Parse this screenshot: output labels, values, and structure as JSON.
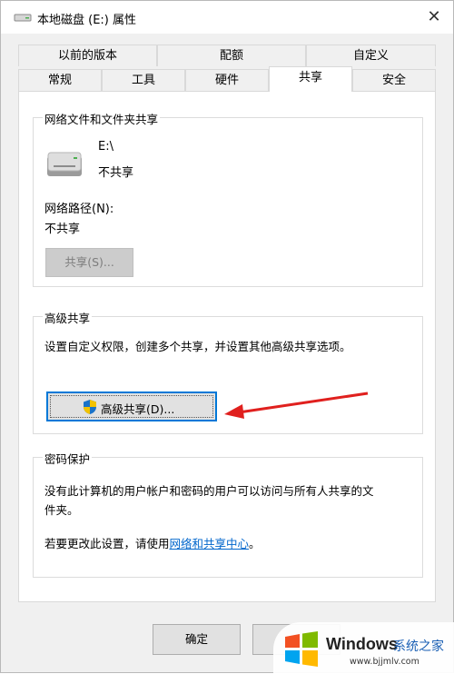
{
  "window": {
    "title": "本地磁盘 (E:) 属性",
    "close": "✕"
  },
  "tabs_top": [
    "以前的版本",
    "配额",
    "自定义"
  ],
  "tabs_bottom": [
    "常规",
    "工具",
    "硬件",
    "共享",
    "安全"
  ],
  "active_tab": "共享",
  "network_group": {
    "title": "网络文件和文件夹共享",
    "drive_name": "E:\\",
    "drive_status": "不共享",
    "path_label": "网络路径(N):",
    "path_value": "不共享",
    "share_button": "共享(S)..."
  },
  "advanced_group": {
    "title": "高级共享",
    "description": "设置自定义权限，创建多个共享，并设置其他高级共享选项。",
    "button": "高级共享(D)..."
  },
  "password_group": {
    "title": "密码保护",
    "text_line1": "没有此计算机的用户帐户和密码的用户可以访问与所有人共享的文",
    "text_line2": "件夹。",
    "change_prefix": "若要更改此设置，请使用",
    "change_link": "网络和共享中心",
    "change_suffix": "。"
  },
  "footer": {
    "ok_button": "确定"
  },
  "watermark": {
    "brand": "Windows",
    "brand_cn": "系统之家",
    "url": "www.bjjmlv.com"
  },
  "colors": {
    "accent": "#0078d7",
    "arrow": "#e0201e",
    "link": "#0066cc"
  }
}
